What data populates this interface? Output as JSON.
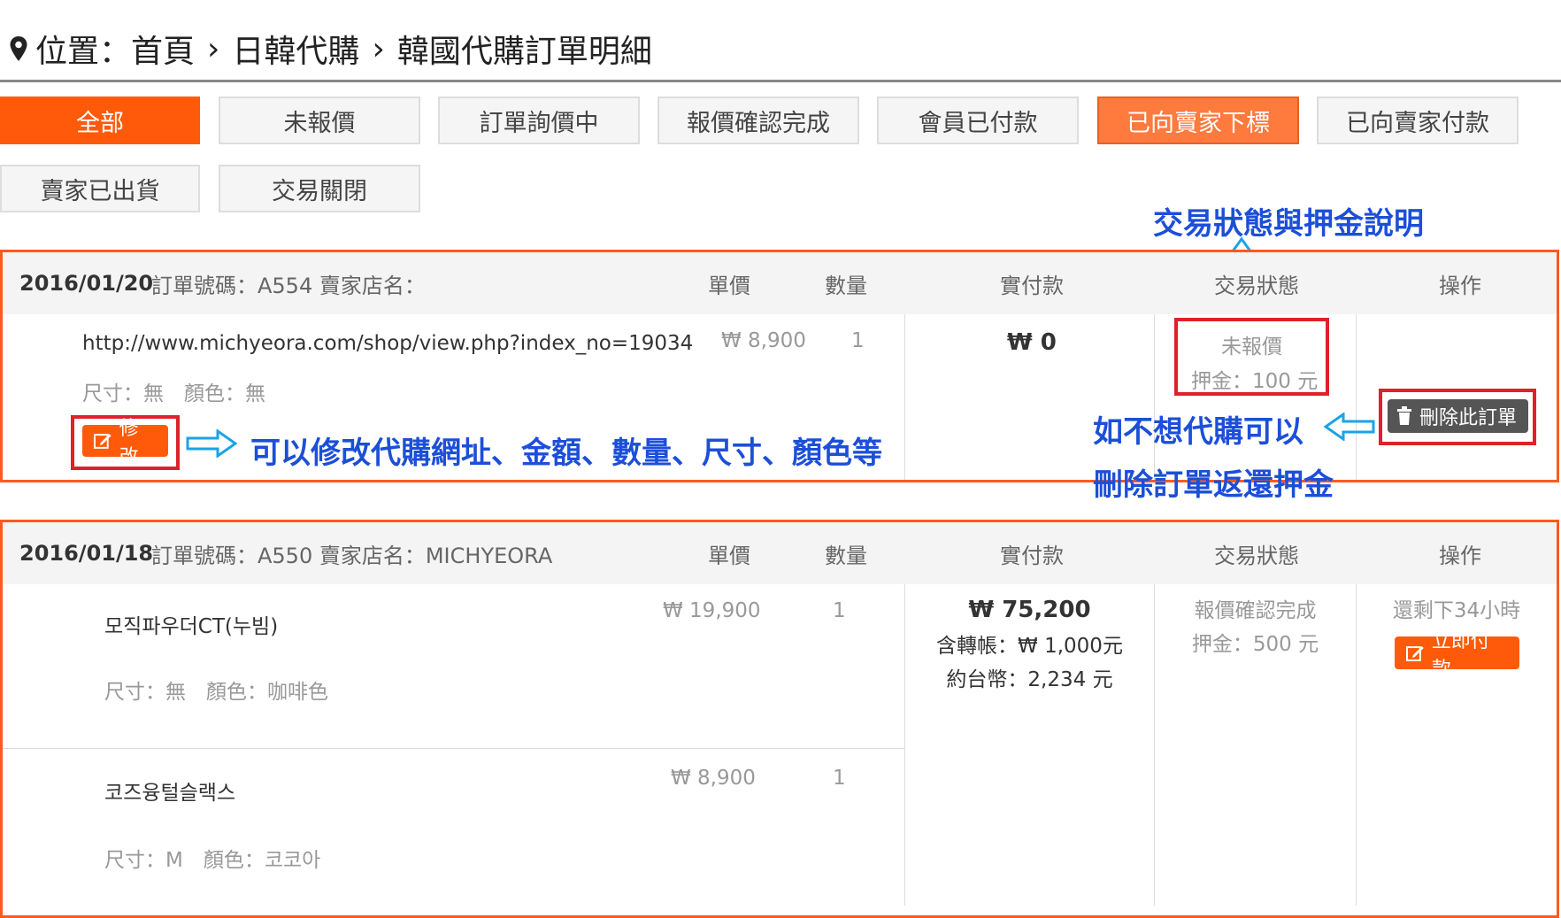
{
  "breadcrumb": {
    "prefix": "位置：首頁",
    "items": [
      "日韓代購",
      "韓國代購訂單明細"
    ],
    "separator": "›"
  },
  "tabs": [
    {
      "label": "全部",
      "state": "active"
    },
    {
      "label": "未報價",
      "state": "normal"
    },
    {
      "label": "訂單詢價中",
      "state": "normal"
    },
    {
      "label": "報價確認完成",
      "state": "normal"
    },
    {
      "label": "會員已付款",
      "state": "normal"
    },
    {
      "label": "已向賣家下標",
      "state": "highlight"
    },
    {
      "label": "已向賣家付款",
      "state": "normal"
    },
    {
      "label": "賣家已出貨",
      "state": "normal"
    },
    {
      "label": "交易關閉",
      "state": "normal"
    }
  ],
  "columns": {
    "unit_price": "單價",
    "quantity": "數量",
    "paid": "實付款",
    "status": "交易狀態",
    "action": "操作"
  },
  "orders": [
    {
      "date": "2016/01/20",
      "order_info": "訂單號碼：A554 賣家店名：",
      "items": [
        {
          "name": "http://www.michyeora.com/shop/view.php?index_no=19034",
          "options": "尺寸：無　顏色：無",
          "price": "₩ 8,900",
          "qty": "1"
        }
      ],
      "paid_main": "₩ 0",
      "status_text": "未報價",
      "deposit": "押金：100 元",
      "edit_label": "修改",
      "delete_label": "刪除此訂單"
    },
    {
      "date": "2016/01/18",
      "order_info": "訂單號碼：A550 賣家店名：MICHYEORA",
      "items": [
        {
          "name": "모직파우더CT(누빔)",
          "options": "尺寸：無　顏色：咖啡色",
          "price": "₩ 19,900",
          "qty": "1"
        },
        {
          "name": "코즈융털슬랙스",
          "options": "尺寸：M　顏色：코코아",
          "price": "₩ 8,900",
          "qty": "1"
        }
      ],
      "paid_main": "₩ 75,200",
      "paid_transfer": "含轉帳：₩ 1,000元",
      "paid_twd": "約台幣：2,234 元",
      "status_text": "報價確認完成",
      "deposit": "押金：500 元",
      "time_left": "還剩下34小時",
      "pay_label": "立即付款"
    }
  ],
  "annotations": {
    "status_note": "交易狀態與押金說明",
    "edit_note": "可以修改代購網址、金額、數量、尺寸、顏色等",
    "delete_note_1": "如不想代購可以",
    "delete_note_2": "刪除訂單返還押金"
  },
  "colors": {
    "accent": "#ff5a0a",
    "annotation_box": "#e0202a",
    "annotation_text": "#1c4fd8",
    "annotation_arrow": "#1aa3e8"
  }
}
